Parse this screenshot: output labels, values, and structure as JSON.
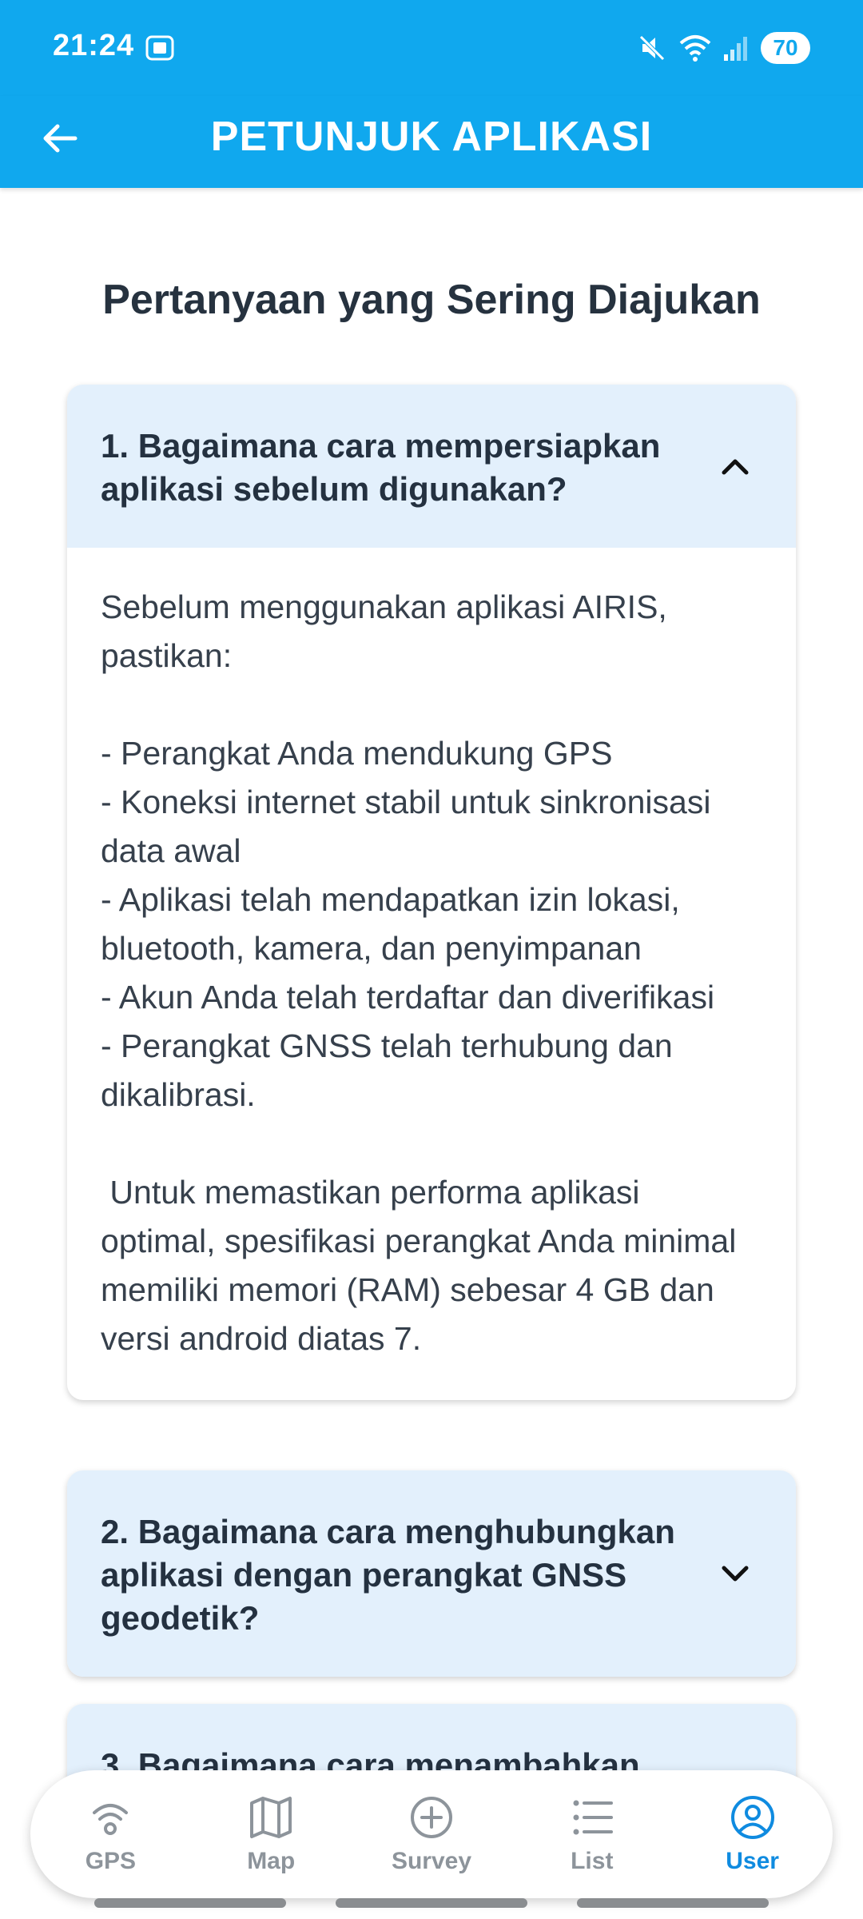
{
  "status_bar": {
    "time": "21:24",
    "battery": "70"
  },
  "app_bar": {
    "title": "PETUNJUK APLIKASI"
  },
  "section_title": "Pertanyaan yang Sering Diajukan",
  "faqs": [
    {
      "question": "1. Bagaimana cara mempersiapkan aplikasi sebelum digunakan?",
      "expanded": true,
      "answer": "Sebelum menggunakan aplikasi AIRIS, pastikan:\n\n- Perangkat Anda mendukung GPS\n- Koneksi internet stabil untuk sinkronisasi data awal\n- Aplikasi telah mendapatkan izin lokasi, bluetooth, kamera, dan penyimpanan\n- Akun Anda telah terdaftar dan diverifikasi\n- Perangkat GNSS telah terhubung dan dikalibrasi.\n\n Untuk memastikan performa aplikasi optimal, spesifikasi perangkat Anda minimal memiliki memori (RAM) sebesar 4 GB dan versi android diatas 7."
    },
    {
      "question": "2. Bagaimana cara menghubungkan aplikasi dengan perangkat GNSS geodetik?",
      "expanded": false
    },
    {
      "question": "3. Bagaimana cara menambahkan",
      "expanded": false
    }
  ],
  "bottom_nav": {
    "items": [
      {
        "label": "GPS",
        "icon": "gps-signal-icon",
        "active": false
      },
      {
        "label": "Map",
        "icon": "map-icon",
        "active": false
      },
      {
        "label": "Survey",
        "icon": "plus-circle-icon",
        "active": false
      },
      {
        "label": "List",
        "icon": "list-icon",
        "active": false
      },
      {
        "label": "User",
        "icon": "user-circle-icon",
        "active": true
      }
    ]
  },
  "colors": {
    "primary": "#10a8ee",
    "card_header": "#e3f0fc",
    "active_nav": "#0f8be0",
    "inactive_nav": "#8d949b"
  }
}
